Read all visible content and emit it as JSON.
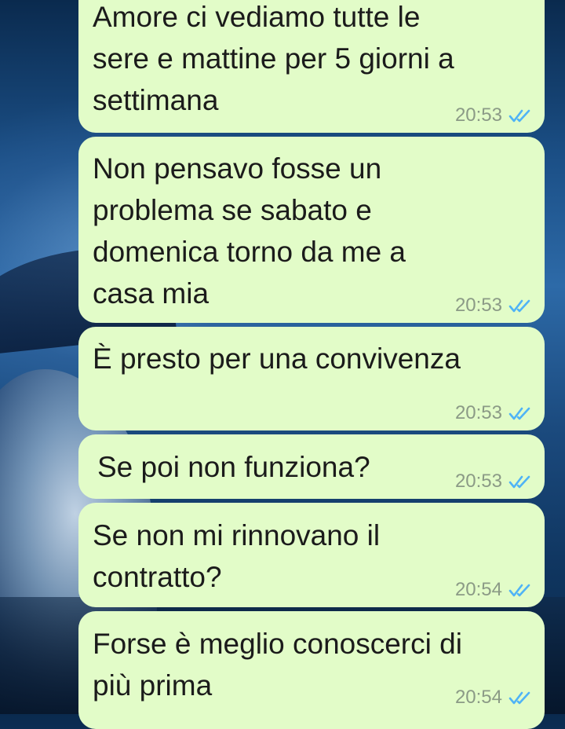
{
  "messages": [
    {
      "lines": [
        "Amore ci vediamo tutte le",
        "sere e mattine per 5 giorni a",
        "settimana"
      ],
      "time": "20:53",
      "status": "read"
    },
    {
      "lines": [
        "Non pensavo fosse un",
        "problema se sabato e",
        "domenica torno da me a",
        "casa mia"
      ],
      "time": "20:53",
      "status": "read"
    },
    {
      "lines": [
        "È presto per una convivenza"
      ],
      "time": "20:53",
      "status": "read"
    },
    {
      "lines": [
        "Se poi non funziona?"
      ],
      "time": "20:53",
      "status": "read"
    },
    {
      "lines": [
        "Se non mi rinnovano il",
        "contratto?"
      ],
      "time": "20:54",
      "status": "read"
    },
    {
      "lines": [
        "Forse è meglio conoscerci di",
        "più prima"
      ],
      "time": "20:54",
      "status": "read"
    }
  ],
  "colors": {
    "bubble": "#e2fcc8",
    "text": "#1b1b1b",
    "timestamp": "#8b9a86",
    "read_ticks": "#4fb3f6"
  },
  "icons": {
    "read_receipt": "double-check-icon"
  }
}
